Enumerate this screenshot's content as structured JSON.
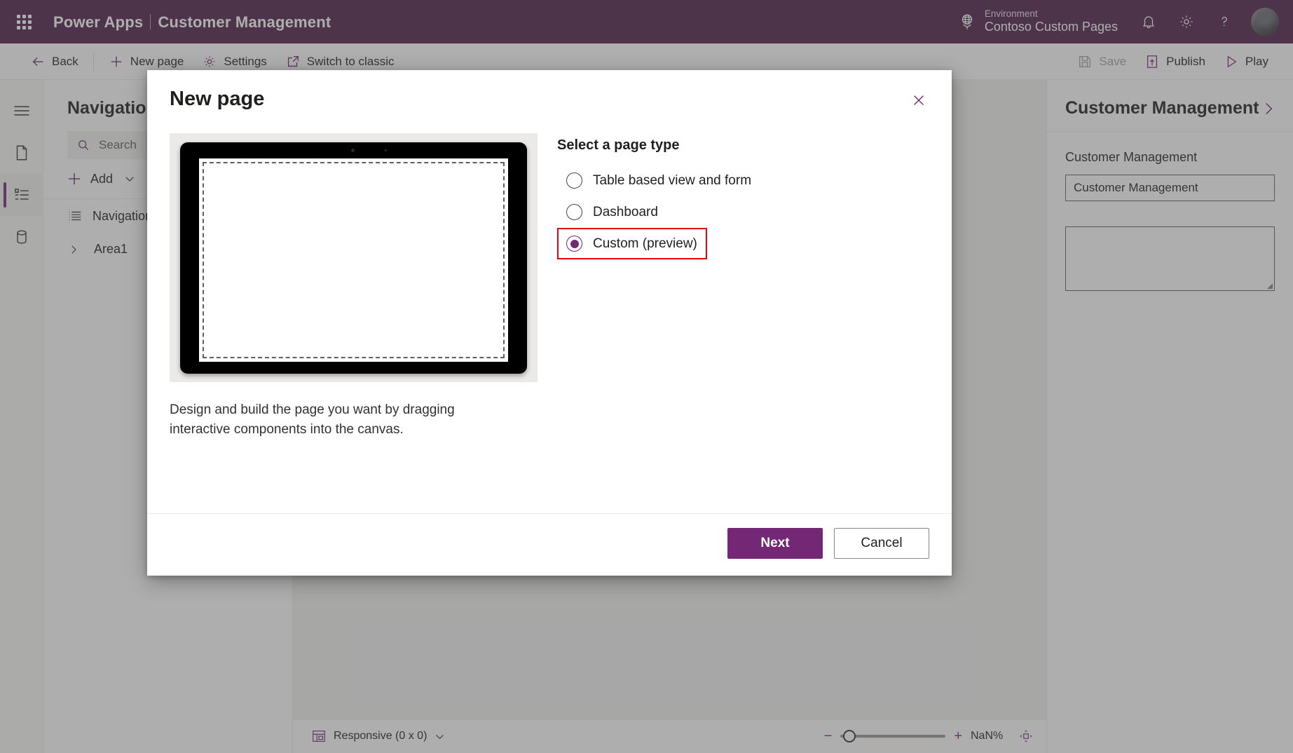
{
  "header": {
    "waffle_icon": "app-launcher-icon",
    "product": "Power Apps",
    "separator": "|",
    "app_name": "Customer Management",
    "environment_icon": "globe-icon",
    "environment_label": "Environment",
    "environment_value": "Contoso Custom Pages",
    "notification_icon": "bell-icon",
    "settings_icon": "gear-icon",
    "help_icon": "question-mark-icon",
    "avatar": "user-avatar",
    "background": "#4f1e46"
  },
  "command_bar": {
    "back": "Back",
    "new_page": "New page",
    "settings": "Settings",
    "switch_to_classic": "Switch to classic",
    "save": "Save",
    "publish": "Publish",
    "play": "Play",
    "accent": "#742774"
  },
  "rail": {
    "items": [
      {
        "name": "hamburger-menu",
        "icon": "hamburger-icon",
        "active": false
      },
      {
        "name": "pages",
        "icon": "page-icon",
        "active": false
      },
      {
        "name": "navigation",
        "icon": "navigation-list-icon",
        "active": true
      },
      {
        "name": "data",
        "icon": "database-icon",
        "active": false
      }
    ]
  },
  "nav_panel": {
    "title": "Navigation",
    "search_placeholder": "Search",
    "search_value": "",
    "add_label": "Add",
    "items": [
      {
        "label": "Navigation",
        "icon": "list-icon"
      },
      {
        "label": "Area1",
        "icon": "chevron-right-icon"
      }
    ]
  },
  "right_panel": {
    "title": "Customer Management",
    "title_visible": "nagement",
    "field_label": "Customer Management",
    "field_label_visible": "gement",
    "field_value": "Customer Management",
    "field_value_visible": "nagement",
    "textarea_value": ""
  },
  "status_bar": {
    "screen_icon": "responsive-layout-icon",
    "size_label": "Responsive (0 x 0)",
    "dropdown_icon": "chevron-down-icon",
    "zoom_minus": "−",
    "zoom_plus": "+",
    "zoom_value": "NaN%",
    "fit_icon": "fit-to-screen-icon"
  },
  "dialog": {
    "title": "New page",
    "close_icon": "close-icon",
    "preview_description": "Design and build the page you want by dragging interactive components into the canvas.",
    "page_type_heading": "Select a page type",
    "page_types": [
      {
        "label": "Table based view and form",
        "selected": false,
        "highlighted": false
      },
      {
        "label": "Dashboard",
        "selected": false,
        "highlighted": false
      },
      {
        "label": "Custom (preview)",
        "selected": true,
        "highlighted": true
      }
    ],
    "primary_button": "Next",
    "secondary_button": "Cancel",
    "highlight_color": "#e8000d",
    "accent_color": "#742774"
  }
}
